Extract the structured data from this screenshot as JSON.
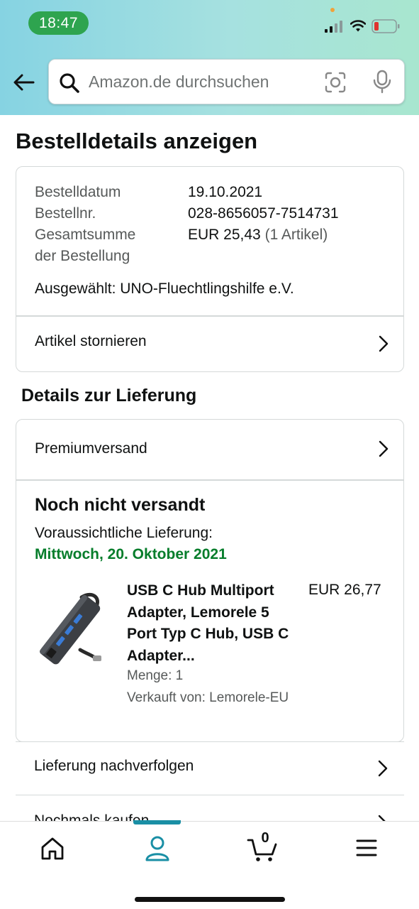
{
  "status_bar": {
    "time": "18:47"
  },
  "search": {
    "placeholder": "Amazon.de durchsuchen"
  },
  "page": {
    "title": "Bestelldetails anzeigen"
  },
  "order_summary": {
    "order_date_label": "Bestelldatum",
    "order_date": "19.10.2021",
    "order_number_label": "Bestellnr.",
    "order_number": "028-8656057-7514731",
    "total_label_line1": "Gesamtsumme",
    "total_label_line2": "der Bestellung",
    "total_value": "EUR 25,43",
    "total_items": "(1 Artikel)",
    "selected_charity": "Ausgewählt: UNO-Fluechtlingshilfe e.V.",
    "cancel_label": "Artikel stornieren"
  },
  "delivery": {
    "section_title": "Details zur Lieferung",
    "shipping_method": "Premiumversand",
    "status": "Noch nicht versandt",
    "expected_label": "Voraussichtliche Lieferung:",
    "expected_date": "Mittwoch, 20. Oktober 2021",
    "accent_color": "#067d2b",
    "product": {
      "title": "USB C Hub Multiport Adapter, Lemorele 5 Port Typ C Hub, USB C Adapter...",
      "price": "EUR 26,77",
      "quantity": "Menge: 1",
      "seller": "Verkauft von: Lemorele-EU"
    }
  },
  "actions": {
    "track": "Lieferung nachverfolgen",
    "buy_again": "Nochmals kaufen"
  },
  "tab_bar": {
    "active_tab": "account",
    "cart_count": "0",
    "accent_color": "#1a8fa5"
  }
}
